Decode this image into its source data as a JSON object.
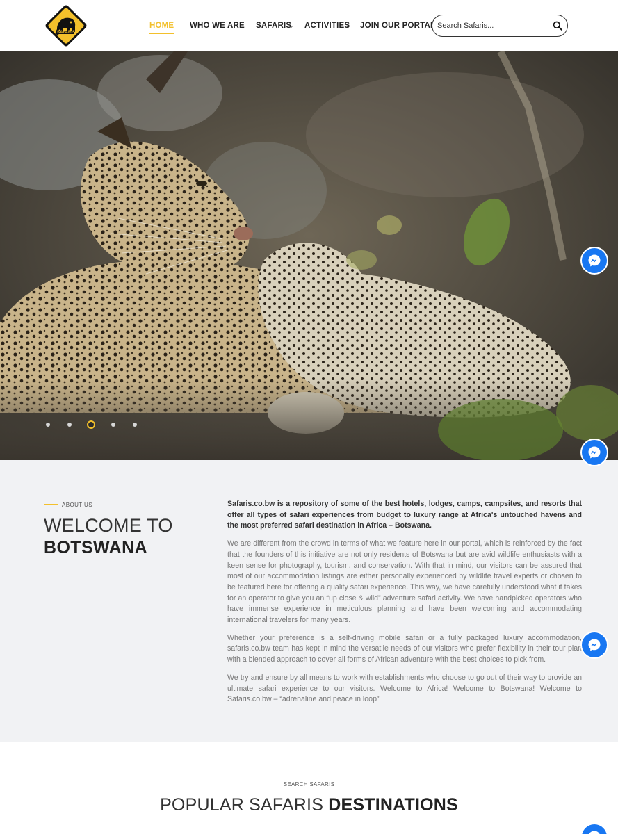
{
  "brand": {
    "logo_text": "SAFARIS",
    "accent_color": "#f3c02b",
    "messenger_color": "#1877f2"
  },
  "nav": {
    "items": [
      {
        "label": "HOME",
        "active": true
      },
      {
        "label": "WHO WE ARE"
      },
      {
        "label": "SAFARIS",
        "has_dropdown": true
      },
      {
        "label": "ACTIVITIES",
        "has_dropdown": true
      },
      {
        "label": "JOIN OUR PORTAL"
      }
    ],
    "search": {
      "placeholder": "Search Safaris...",
      "icon": "search-icon"
    }
  },
  "hero": {
    "image": "leopard mother and cub resting on rocky ground",
    "slides_count": 5,
    "active_slide": 3
  },
  "about": {
    "eyebrow": "ABOUT US",
    "heading_line1": "WELCOME TO",
    "heading_line2": "BOTSWANA",
    "lead": "Safaris.co.bw is a repository of some of the best hotels, lodges, camps, campsites, and resorts that offer all types of safari experiences from budget to luxury range at Africa's untouched havens and the most preferred safari destination in Africa – Botswana.",
    "paragraphs": [
      "We are different from the crowd in terms of what we feature here in our portal, which is reinforced by the fact that the founders of this initiative are not only residents of Botswana but are avid wildlife enthusiasts with a keen sense for photography, tourism, and conservation. With that in mind, our visitors can be assured that most of our accommodation listings are either personally experienced by wildlife travel experts or chosen to be featured here for offering a quality safari experience. This way, we have carefully understood what it takes for an operator to give you an “up close & wild” adventure safari activity. We have handpicked operators who have immense experience in meticulous planning and have been welcoming and accommodating international travelers for many years.",
      "Whether your preference is a self-driving mobile safari or a fully packaged luxury accommodation, safaris.co.bw team has kept in mind the versatile needs of our visitors who prefer flexibility in their tour plan with a blended approach to cover all forms of African adventure with the best choices to pick from.",
      "We try and ensure by all means to work with establishments who choose to go out of their way to provide an ultimate safari experience to our visitors. Welcome to Africa! Welcome to Botswana! Welcome to Safaris.co.bw – “adrenaline and peace in loop”"
    ]
  },
  "destinations": {
    "eyebrow": "SEARCH SAFARIS",
    "title_light": "POPULAR SAFARIS",
    "title_bold": "DESTINATIONS"
  },
  "messenger": {
    "icon": "messenger-icon",
    "count": 4
  }
}
